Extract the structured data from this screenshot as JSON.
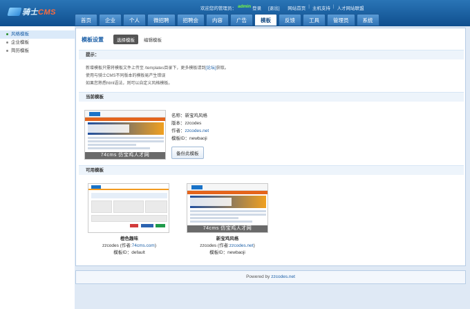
{
  "header": {
    "logo_text_a": "骑士",
    "logo_text_b": "CMS",
    "welcome": "欢迎您的管理员：",
    "admin_name": "admin",
    "login_label": "登录",
    "logout": "[退出]",
    "links": [
      "网站首页",
      "主机支持",
      "人才网站联盟"
    ]
  },
  "nav": {
    "tabs": [
      "首页",
      "企业",
      "个人",
      "微招聘",
      "招聘会",
      "内容",
      "广告",
      "模板",
      "反馈",
      "工具",
      "管理员",
      "系统"
    ],
    "active": "模板"
  },
  "sidebar": {
    "items": [
      "风格模板",
      "企业模板",
      "简历模板"
    ],
    "active": "风格模板"
  },
  "main": {
    "title": "模板设置",
    "btn_select": "选择模板",
    "btn_edit": "编辑模板",
    "tips_title": "提示：",
    "tips": [
      "新增模板只需将模板文件上传至 /templates目录下，更多模板请到",
      "[论坛]",
      "获取。",
      "使用与骑士CMS不同版本的模板易产生错误",
      "如果您熟悉html语法，则可以自定义风格模板。"
    ],
    "current_title": "当前模板",
    "current": {
      "name_label": "名称：",
      "name": "新宝鸡风格",
      "version_label": "版本：",
      "version": "zzcodes",
      "author_label": "作者：",
      "author": "zzcodes.net",
      "id_label": "模板ID：",
      "id": "newbaoji",
      "caption": "74cms 仿宝鸡人才网",
      "backup": "备份此模板"
    },
    "available_title": "可用模板",
    "available": [
      {
        "name": "橙色趣味",
        "author_prefix": "zzcodes (作者:",
        "author": "74cms.com",
        "author_suffix": ")",
        "id_label": "模板ID：",
        "id": "default"
      },
      {
        "name": "新宝鸡风格",
        "author_prefix": "zzcodes (作者:",
        "author": "zzcodes.net",
        "author_suffix": ")",
        "id_label": "模板ID：",
        "id": "newbaoji",
        "caption": "74cms 仿宝鸡人才网"
      }
    ]
  },
  "footer": {
    "prefix": "Powered by ",
    "link": "zzcodes.net"
  }
}
